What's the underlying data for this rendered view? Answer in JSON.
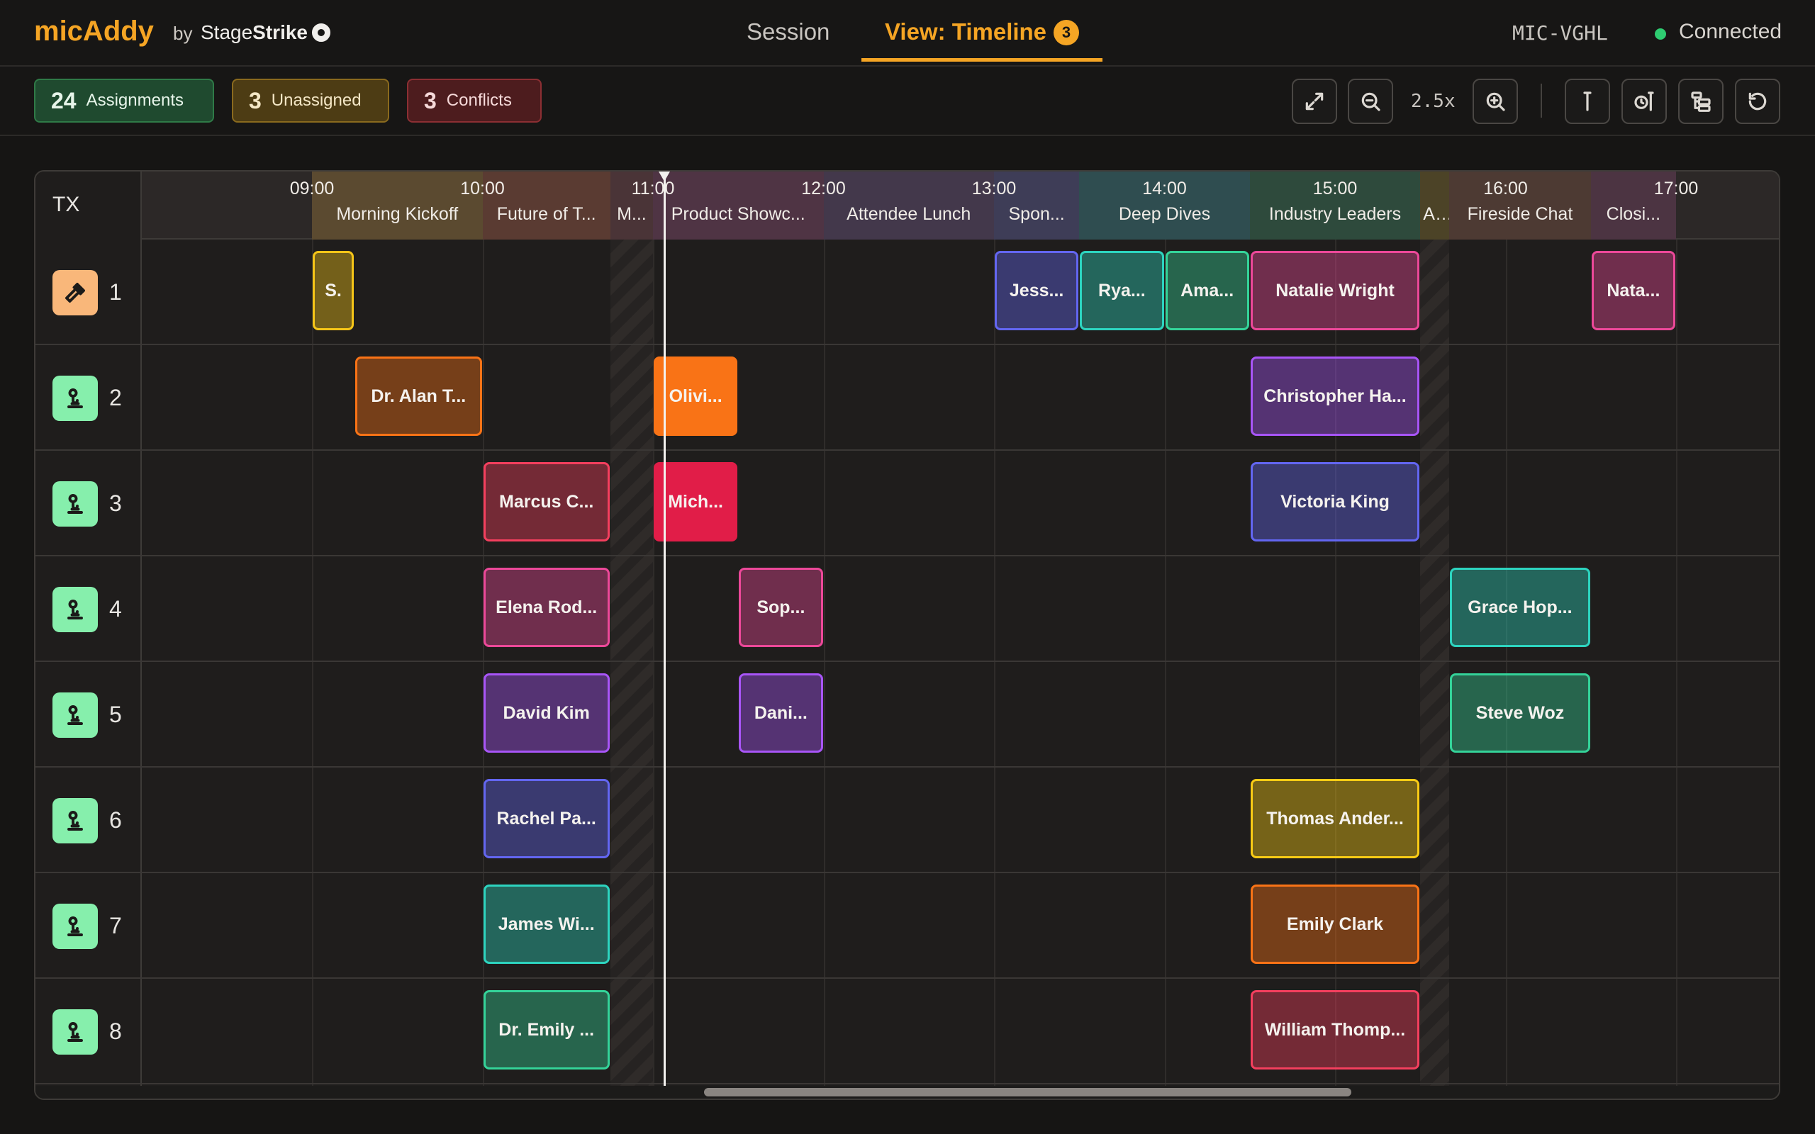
{
  "app": {
    "brand": "micAddy",
    "by": "by",
    "company_prefix": "Stage",
    "company_suffix": "Strike"
  },
  "nav": {
    "session_label": "Session",
    "timeline_label": "View: Timeline",
    "timeline_badge": "3",
    "device_id": "MIC-VGHL",
    "status": "Connected",
    "status_color": "#2ecc71"
  },
  "toolbar": {
    "assignments_count": "24",
    "assignments_label": "Assignments",
    "unassigned_count": "3",
    "unassigned_label": "Unassigned",
    "conflicts_count": "3",
    "conflicts_label": "Conflicts",
    "zoom": "2.5x",
    "icons": [
      "expand-icon",
      "zoom-out-icon",
      "zoom-in-icon",
      "marker-icon",
      "clock-marker-icon",
      "layout-icon",
      "reset-icon"
    ]
  },
  "timeline": {
    "tx_header": "TX",
    "start_hour": 8.2,
    "times": [
      "09:00",
      "10:00",
      "11:00",
      "12:00",
      "13:00",
      "14:00",
      "15:00",
      "16:00",
      "17:00"
    ],
    "now": "11:26",
    "sessions": [
      {
        "name": "Morning Kickoff",
        "start": 9.0,
        "end": 10.0,
        "color": "#5b4a30"
      },
      {
        "name": "Future of T...",
        "start": 10.0,
        "end": 10.75,
        "color": "#5a3b32"
      },
      {
        "name": "M...",
        "start": 10.75,
        "end": 11.0,
        "color": "#4a3437"
      },
      {
        "name": "Product Showc...",
        "start": 11.0,
        "end": 12.0,
        "color": "#4f3444"
      },
      {
        "name": "Attendee Lunch",
        "start": 12.0,
        "end": 13.0,
        "color": "#43384b"
      },
      {
        "name": "Spon...",
        "start": 13.0,
        "end": 13.5,
        "color": "#3e3d57"
      },
      {
        "name": "Deep Dives",
        "start": 13.5,
        "end": 14.5,
        "color": "#2f4d50"
      },
      {
        "name": "Industry Leaders",
        "start": 14.5,
        "end": 15.5,
        "color": "#2e4a3c"
      },
      {
        "name": "A...",
        "start": 15.5,
        "end": 15.67,
        "color": "#4c4327"
      },
      {
        "name": "Fireside Chat",
        "start": 15.67,
        "end": 16.5,
        "color": "#4d3a33"
      },
      {
        "name": "Closi...",
        "start": 16.5,
        "end": 17.0,
        "color": "#4c3442"
      }
    ],
    "gaps": [
      [
        10.75,
        11.0
      ],
      [
        15.5,
        15.67
      ]
    ],
    "rows": [
      {
        "tx": "1",
        "icon": "microphone-icon",
        "icon_color": "#f9b77a",
        "blocks": [
          {
            "label": "S.",
            "start": 9.0,
            "end": 9.25,
            "color": "#f5c518"
          },
          {
            "label": "Jess...",
            "start": 13.0,
            "end": 13.5,
            "color": "#6366f1"
          },
          {
            "label": "Rya...",
            "start": 13.5,
            "end": 14.0,
            "color": "#2dd4bf"
          },
          {
            "label": "Ama...",
            "start": 14.0,
            "end": 14.5,
            "color": "#34d399"
          },
          {
            "label": "Natalie Wright",
            "start": 14.5,
            "end": 15.5,
            "color": "#ec4899"
          },
          {
            "label": "Nata...",
            "start": 16.5,
            "end": 17.0,
            "color": "#ec4899"
          }
        ]
      },
      {
        "tx": "2",
        "icon": "lavalier-icon",
        "icon_color": "#86efac",
        "blocks": [
          {
            "label": "Dr. Alan T...",
            "start": 9.25,
            "end": 10.0,
            "color": "#f97316"
          },
          {
            "label": "Olivi...",
            "start": 11.0,
            "end": 11.5,
            "color": "#f97316",
            "solid": true
          },
          {
            "label": "Christopher Ha...",
            "start": 14.5,
            "end": 15.5,
            "color": "#a855f7"
          }
        ]
      },
      {
        "tx": "3",
        "icon": "lavalier-icon",
        "icon_color": "#86efac",
        "blocks": [
          {
            "label": "Marcus C...",
            "start": 10.0,
            "end": 10.75,
            "color": "#f43f5e"
          },
          {
            "label": "Mich...",
            "start": 11.0,
            "end": 11.5,
            "color": "#e11d48",
            "solid": true
          },
          {
            "label": "Victoria King",
            "start": 14.5,
            "end": 15.5,
            "color": "#6366f1"
          }
        ]
      },
      {
        "tx": "4",
        "icon": "lavalier-icon",
        "icon_color": "#86efac",
        "blocks": [
          {
            "label": "Elena Rod...",
            "start": 10.0,
            "end": 10.75,
            "color": "#ec4899"
          },
          {
            "label": "Sop...",
            "start": 11.5,
            "end": 12.0,
            "color": "#ec4899"
          },
          {
            "label": "Grace Hop...",
            "start": 15.67,
            "end": 16.5,
            "color": "#2dd4bf"
          }
        ]
      },
      {
        "tx": "5",
        "icon": "lavalier-icon",
        "icon_color": "#86efac",
        "blocks": [
          {
            "label": "David Kim",
            "start": 10.0,
            "end": 10.75,
            "color": "#a855f7"
          },
          {
            "label": "Dani...",
            "start": 11.5,
            "end": 12.0,
            "color": "#a855f7"
          },
          {
            "label": "Steve Woz",
            "start": 15.67,
            "end": 16.5,
            "color": "#34d399"
          }
        ]
      },
      {
        "tx": "6",
        "icon": "lavalier-icon",
        "icon_color": "#86efac",
        "blocks": [
          {
            "label": "Rachel Pa...",
            "start": 10.0,
            "end": 10.75,
            "color": "#6366f1"
          },
          {
            "label": "Thomas Ander...",
            "start": 14.5,
            "end": 15.5,
            "color": "#facc15"
          }
        ]
      },
      {
        "tx": "7",
        "icon": "lavalier-icon",
        "icon_color": "#86efac",
        "blocks": [
          {
            "label": "James Wi...",
            "start": 10.0,
            "end": 10.75,
            "color": "#2dd4bf"
          },
          {
            "label": "Emily Clark",
            "start": 14.5,
            "end": 15.5,
            "color": "#f97316"
          }
        ]
      },
      {
        "tx": "8",
        "icon": "lavalier-icon",
        "icon_color": "#86efac",
        "blocks": [
          {
            "label": "Dr. Emily ...",
            "start": 10.0,
            "end": 10.75,
            "color": "#34d399"
          },
          {
            "label": "William Thomp...",
            "start": 14.5,
            "end": 15.5,
            "color": "#f43f5e"
          }
        ]
      }
    ]
  }
}
